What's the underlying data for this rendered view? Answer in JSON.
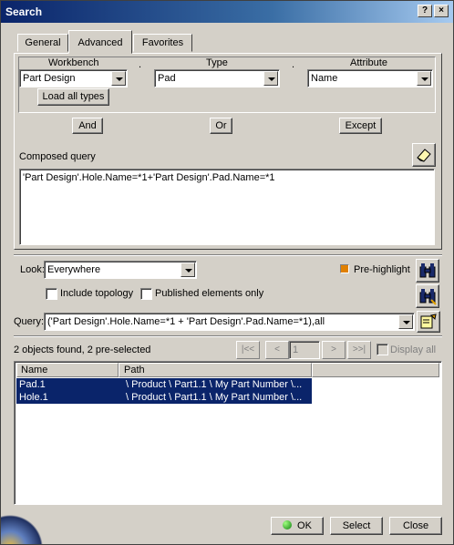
{
  "window": {
    "title": "Search",
    "help_btn": "?",
    "close_btn": "×"
  },
  "tabs": [
    {
      "label": "General",
      "active": false
    },
    {
      "label": "Advanced",
      "active": true
    },
    {
      "label": "Favorites",
      "active": false
    }
  ],
  "advanced": {
    "workbench_label": "Workbench",
    "type_label": "Type",
    "attribute_label": "Attribute",
    "workbench_value": "Part Design",
    "type_value": "Pad",
    "attribute_value": "Name",
    "separator_dot": ".",
    "load_all_types": "Load all types",
    "and_btn": "And",
    "or_btn": "Or",
    "except_btn": "Except",
    "composed_query_label": "Composed query",
    "composed_query_text": "'Part Design'.Hole.Name=*1+'Part Design'.Pad.Name=*1"
  },
  "options": {
    "look_label": "Look:",
    "look_value": "Everywhere",
    "pre_highlight_label": "Pre-highlight",
    "include_topology_label": "Include topology",
    "published_only_label": "Published elements only",
    "query_label": "Query:",
    "query_value": "('Part Design'.Hole.Name=*1 + 'Part Design'.Pad.Name=*1),all"
  },
  "results": {
    "status": "2 objects found, 2 pre-selected",
    "page_value": "1",
    "nav": {
      "first": "|<<",
      "prev": "<",
      "next": ">",
      "last": ">>|"
    },
    "display_all_label": "Display all",
    "columns": [
      "Name",
      "Path"
    ],
    "rows": [
      {
        "name": "Pad.1",
        "path": "\\ Product \\ Part1.1 \\ My Part Number \\..."
      },
      {
        "name": "Hole.1",
        "path": "\\ Product \\ Part1.1 \\ My Part Number \\..."
      }
    ]
  },
  "footer": {
    "ok": "OK",
    "select": "Select",
    "close": "Close"
  },
  "colors": {
    "title_bar": "#0a246a",
    "selection": "#0a246a",
    "face": "#d4d0c8",
    "pre_highlight": "#e08000"
  },
  "icons": [
    "help-icon",
    "close-icon",
    "eraser-icon",
    "binoculars-icon",
    "binoculars-selected-icon",
    "edit-favorite-icon",
    "ok-icon"
  ]
}
